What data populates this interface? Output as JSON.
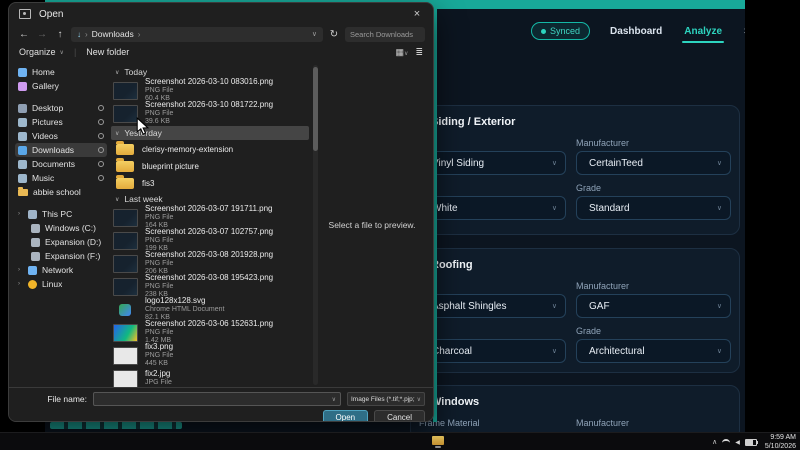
{
  "dialog": {
    "title": "Open",
    "nav": {
      "breadcrumb": [
        "Downloads"
      ],
      "search_placeholder": "Search Downloads"
    },
    "toolbar": {
      "organize_label": "Organize",
      "new_folder_label": "New folder"
    },
    "sidebar": {
      "quick": [
        {
          "label": "Home",
          "icon": "home-icon",
          "color": "#6fb3f2"
        },
        {
          "label": "Gallery",
          "icon": "gallery-icon",
          "color": "#cf9bf0"
        }
      ],
      "pinned": [
        {
          "label": "Desktop",
          "icon": "desktop-icon",
          "color": "#8f9fb3",
          "pinned": true
        },
        {
          "label": "Pictures",
          "icon": "pictures-icon",
          "color": "#9db7cc",
          "pinned": true
        },
        {
          "label": "Videos",
          "icon": "videos-icon",
          "color": "#9db7cc",
          "pinned": true
        },
        {
          "label": "Downloads",
          "icon": "downloads-icon",
          "color": "#5aa7e8",
          "pinned": true,
          "selected": true
        },
        {
          "label": "Documents",
          "icon": "documents-icon",
          "color": "#9db7cc",
          "pinned": true
        },
        {
          "label": "Music",
          "icon": "music-icon",
          "color": "#9db7cc",
          "pinned": true
        },
        {
          "label": "abbie school",
          "icon": "folder-icon",
          "color": "#e9b954"
        }
      ],
      "tree": [
        {
          "label": "This PC",
          "icon": "computer-icon",
          "color": "#9fb4c8",
          "chevron": true
        },
        {
          "label": "Windows (C:)",
          "icon": "drive-icon",
          "color": "#aab4bf",
          "indent": true
        },
        {
          "label": "Expansion (D:)",
          "icon": "drive-icon",
          "color": "#aab4bf",
          "indent": true
        },
        {
          "label": "Expansion (F:)",
          "icon": "drive-icon",
          "color": "#aab4bf",
          "indent": true
        },
        {
          "label": "Network",
          "icon": "network-icon",
          "color": "#6fb3f2",
          "chevron": true
        },
        {
          "label": "Linux",
          "icon": "linux-icon",
          "color": "#f0b429",
          "chevron": true
        }
      ]
    },
    "file_groups": [
      {
        "name": "Today",
        "items": [
          {
            "name": "Screenshot 2026-03-10 083016.png",
            "type": "PNG File",
            "size": "60.4 KB",
            "thumb": "dark"
          },
          {
            "name": "Screenshot 2026-03-10 081722.png",
            "type": "PNG File",
            "size": "39.6 KB",
            "thumb": "dark"
          }
        ]
      },
      {
        "name": "Yesterday",
        "highlighted": true,
        "items": [
          {
            "name": "clerisy-memory-extension",
            "thumb": "folder"
          },
          {
            "name": "blueprint picture",
            "thumb": "folder"
          },
          {
            "name": "fis3",
            "thumb": "folder"
          }
        ]
      },
      {
        "name": "Last week",
        "items": [
          {
            "name": "Screenshot 2026-03-07 191711.png",
            "type": "PNG File",
            "size": "164 KB",
            "thumb": "dark"
          },
          {
            "name": "Screenshot 2026-03-07 102757.png",
            "type": "PNG File",
            "size": "199 KB",
            "thumb": "dark"
          },
          {
            "name": "Screenshot 2026-03-08 201928.png",
            "type": "PNG File",
            "size": "206 KB",
            "thumb": "dark"
          },
          {
            "name": "Screenshot 2026-03-08 195423.png",
            "type": "PNG File",
            "size": "238 KB",
            "thumb": "dark"
          },
          {
            "name": "logo128x128.svg",
            "type": "Chrome HTML Document",
            "size": "82.1 KB",
            "thumb": "chrome"
          },
          {
            "name": "Screenshot 2026-03-06 152631.png",
            "type": "PNG File",
            "size": "1.42 MB",
            "thumb": "colorful"
          },
          {
            "name": "fix3.png",
            "type": "PNG File",
            "size": "445 KB",
            "thumb": "light"
          },
          {
            "name": "fix2.jpg",
            "type": "JPG File",
            "size": "",
            "thumb": "light"
          }
        ]
      }
    ],
    "preview_text": "Select a file to preview.",
    "footer": {
      "file_name_label": "File name:",
      "file_name_value": "",
      "file_type_value": "Image Files (*.tif;*.pjp;*.j",
      "open_label": "Open",
      "cancel_label": "Cancel"
    }
  },
  "app": {
    "accent_color": "#14b8a6",
    "header": {
      "synced_label": "Synced",
      "tabs": [
        {
          "label": "Dashboard",
          "active": false
        },
        {
          "label": "Analyze",
          "active": true
        },
        {
          "label": "Settings",
          "active": false
        }
      ]
    },
    "sections": [
      {
        "title": "Siding / Exterior",
        "rows": [
          {
            "left_value": "Vinyl Siding",
            "right_label": "Manufacturer",
            "right_value": "CertainTeed"
          },
          {
            "left_value": "White",
            "right_label": "Grade",
            "right_value": "Standard"
          }
        ]
      },
      {
        "title": "Roofing",
        "rows": [
          {
            "left_value": "Asphalt Shingles",
            "right_label": "Manufacturer",
            "right_value": "GAF"
          },
          {
            "left_value": "Charcoal",
            "right_label": "Grade",
            "right_value": "Architectural"
          }
        ]
      },
      {
        "title": "Windows",
        "rows": [
          {
            "left_label": "Frame Material",
            "right_label": "Manufacturer"
          }
        ]
      }
    ]
  },
  "taskbar": {
    "time": "9:59 AM",
    "date": "5/10/2026"
  }
}
